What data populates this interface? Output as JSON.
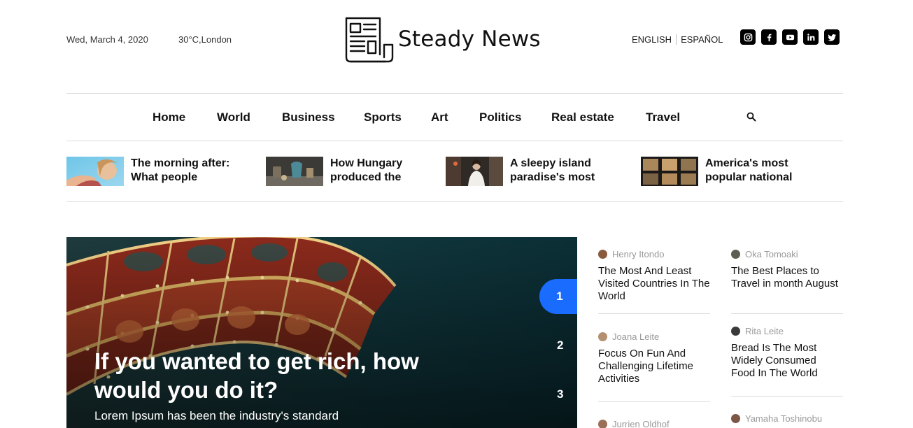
{
  "header": {
    "date": "Wed, March 4, 2020",
    "weather": "30°C,London",
    "logo_text": "Steady News",
    "languages": [
      "ENGLISH",
      "ESPAÑOL"
    ],
    "socials": [
      "instagram-icon",
      "facebook-icon",
      "youtube-icon",
      "linkedin-icon",
      "twitter-icon"
    ]
  },
  "nav": {
    "items": [
      "Home",
      "World",
      "Business",
      "Sports",
      "Art",
      "Politics",
      "Real estate",
      "Travel"
    ]
  },
  "trending": [
    {
      "title": "The morning after: What people"
    },
    {
      "title": "How Hungary produced the"
    },
    {
      "title": "A sleepy island paradise's most"
    },
    {
      "title": "America's most popular national"
    }
  ],
  "hero": {
    "title": "If you wanted to get rich, how would you do it?",
    "subtitle": "Lorem Ipsum has been the industry's standard",
    "slides": [
      "1",
      "2",
      "3"
    ],
    "active_slide": "1",
    "accent": "#1a6cff"
  },
  "side_posts": [
    {
      "author": "Henry Itondo",
      "title": "The Most And Least Visited Countries In The World"
    },
    {
      "author": "Oka Tomoaki",
      "title": "The Best Places to Travel in month August"
    },
    {
      "author": "Joana Leite",
      "title": "Focus On Fun And Challenging Lifetime Activities"
    },
    {
      "author": "Rita Leite",
      "title": "Bread Is The Most Widely Consumed Food In The World"
    },
    {
      "author": "Jurrien Oldhof",
      "title": ""
    },
    {
      "author": "Yamaha Toshinobu",
      "title": ""
    }
  ]
}
